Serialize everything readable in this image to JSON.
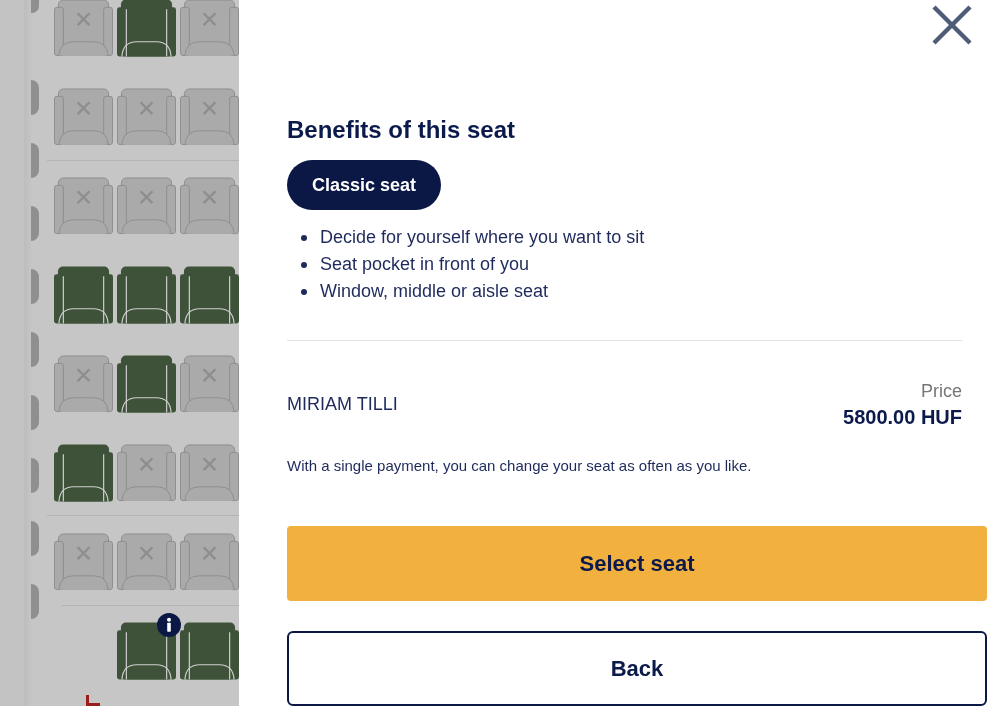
{
  "seat_map": {
    "rows": [
      {
        "seats": [
          {
            "kind": "taken",
            "info": false
          },
          {
            "kind": "free",
            "info": false
          },
          {
            "kind": "taken",
            "info": false
          }
        ]
      },
      {
        "seats": [
          {
            "kind": "taken",
            "info": false
          },
          {
            "kind": "taken",
            "info": false
          },
          {
            "kind": "taken",
            "info": false
          }
        ]
      },
      {
        "seats": [
          {
            "kind": "taken",
            "info": false
          },
          {
            "kind": "taken",
            "info": false
          },
          {
            "kind": "taken",
            "info": false
          }
        ]
      },
      {
        "seats": [
          {
            "kind": "free",
            "info": false
          },
          {
            "kind": "free",
            "info": false
          },
          {
            "kind": "free",
            "info": false
          }
        ]
      },
      {
        "seats": [
          {
            "kind": "taken",
            "info": false
          },
          {
            "kind": "free",
            "info": false
          },
          {
            "kind": "taken",
            "info": false
          }
        ]
      },
      {
        "seats": [
          {
            "kind": "free",
            "info": false
          },
          {
            "kind": "taken",
            "info": false
          },
          {
            "kind": "taken",
            "info": false
          }
        ]
      },
      {
        "seats": [
          {
            "kind": "taken",
            "info": false
          },
          {
            "kind": "taken",
            "info": false
          },
          {
            "kind": "taken",
            "info": false
          }
        ]
      },
      {
        "seats": [
          {
            "kind": "none"
          },
          {
            "kind": "free",
            "info": true
          },
          {
            "kind": "free",
            "info": false
          }
        ]
      }
    ]
  },
  "panel": {
    "heading": "Benefits of this seat",
    "seat_class": "Classic seat",
    "benefits": [
      "Decide for yourself where you want to sit",
      "Seat pocket in front of you",
      "Window, middle or aisle seat"
    ],
    "passenger": "MIRIAM TILLI",
    "price_label": "Price",
    "price": "5800.00 HUF",
    "note": "With a single payment, you can change your seat as often as you like.",
    "buttons": [
      {
        "label": "Select seat",
        "kind": "primary"
      },
      {
        "label": "Back",
        "kind": "secondary"
      }
    ]
  }
}
